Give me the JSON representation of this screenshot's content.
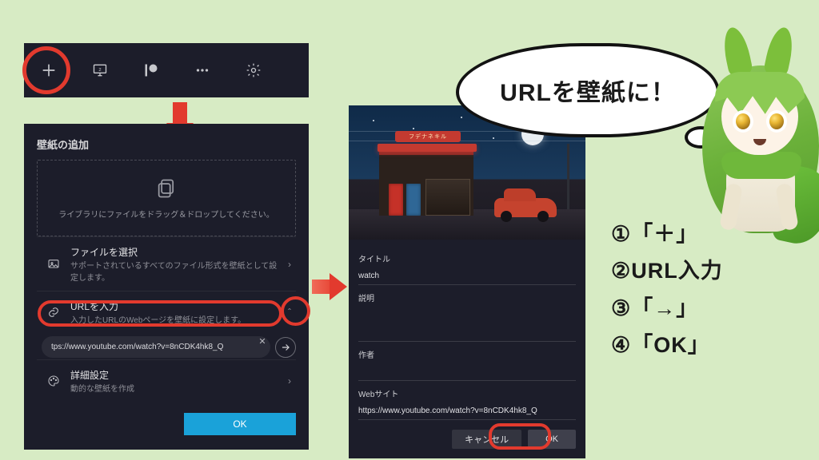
{
  "toolbar": {
    "plus": "＋",
    "display": "display-icon",
    "patreon": "patreon-icon",
    "more": "more-icon",
    "settings": "gear-icon"
  },
  "panel1": {
    "title": "壁紙の追加",
    "drop_hint": "ライブラリにファイルをドラッグ＆ドロップしてください。",
    "opt_file_title": "ファイルを選択",
    "opt_file_sub": "サポートされているすべてのファイル形式を壁紙として設定します。",
    "opt_url_title": "URLを入力",
    "opt_url_sub": "入力したURLのWebページを壁紙に設定します。",
    "url_value": "tps://www.youtube.com/watch?v=8nCDK4hk8_Q",
    "opt_adv_title": "詳細設定",
    "opt_adv_sub": "動的な壁紙を作成",
    "ok": "OK"
  },
  "panel2": {
    "sign": "フデナネキル",
    "label_title": "タイトル",
    "value_title": "watch",
    "label_desc": "説明",
    "label_author": "作者",
    "label_site": "Webサイト",
    "value_site": "https://www.youtube.com/watch?v=8nCDK4hk8_Q",
    "cancel": "キャンセル",
    "ok": "OK"
  },
  "bubble": "URLを壁紙に！",
  "steps": {
    "s1": "①「＋」",
    "s2": "②URL入力",
    "s3": "③「→」",
    "s4": "④「OK」"
  }
}
